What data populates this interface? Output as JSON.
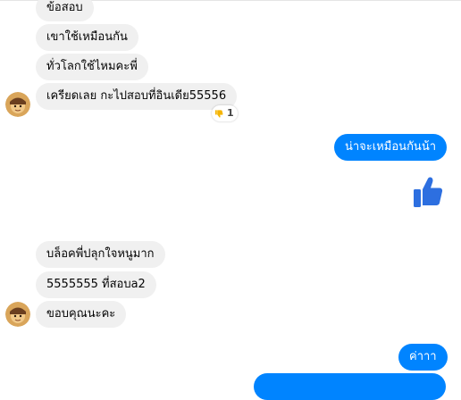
{
  "colors": {
    "incoming_bubble": "#f0f0f0",
    "outgoing_bubble": "#0084ff",
    "like_icon": "#2d6fe0"
  },
  "messages": [
    {
      "text": "ข้อสอบ",
      "direction": "incoming"
    },
    {
      "text": "เขาใช้เหมือนกัน",
      "direction": "incoming"
    },
    {
      "text": "ทั่วโลกใช้ไหมคะพี่",
      "direction": "incoming"
    },
    {
      "text": "เครียดเลย กะไปสอบที่อินเดีย55556",
      "direction": "incoming",
      "reaction": {
        "icon": "thumbs-down-icon",
        "count": "1"
      }
    },
    {
      "text": "น่าจะเหมือนกันน้า",
      "direction": "outgoing"
    },
    {
      "icon": "thumbs-up-icon",
      "direction": "outgoing"
    },
    {
      "text": "บล็อคพี่ปลุกใจหนูมาก",
      "direction": "incoming"
    },
    {
      "text": "5555555 ที่สอบa2",
      "direction": "incoming"
    },
    {
      "text": "ขอบคุณนะคะ",
      "direction": "incoming"
    },
    {
      "text": "ค่าาา",
      "direction": "outgoing"
    }
  ]
}
